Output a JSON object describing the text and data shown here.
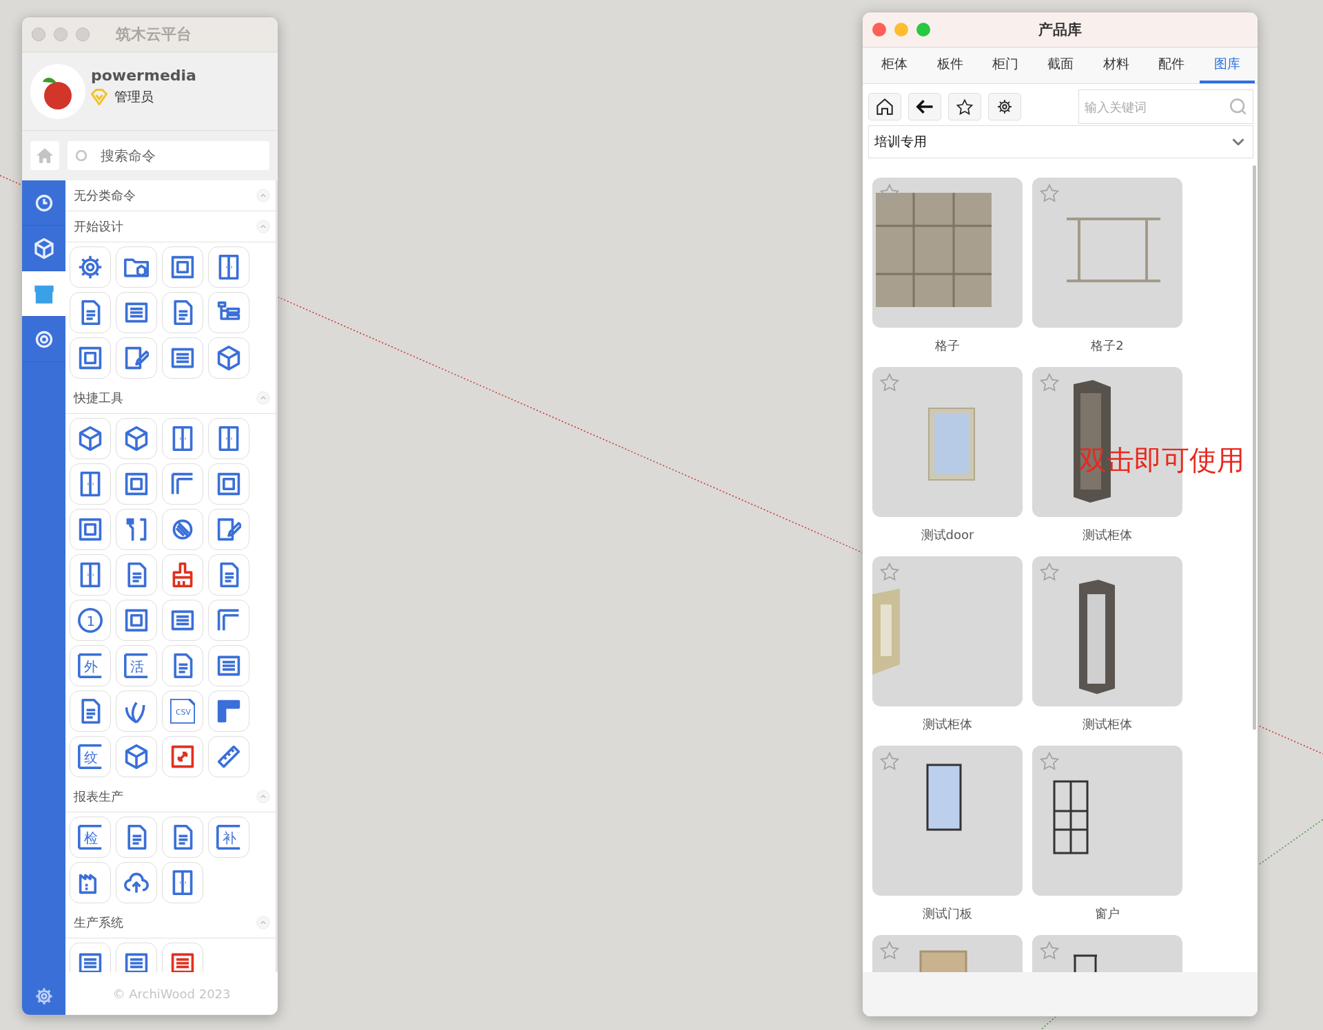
{
  "left_window": {
    "title": "筑木云平台",
    "user": {
      "name": "powermedia",
      "role": "管理员"
    },
    "search": {
      "placeholder": "搜索命令"
    },
    "nav": [
      {
        "selected": false
      },
      {
        "selected": false
      },
      {
        "selected": true
      },
      {
        "selected": false
      }
    ],
    "sections": [
      {
        "title": "无分类命令"
      },
      {
        "title": "开始设计",
        "tools": [
          {
            "kind": "gear",
            "color": "#3a6fd8"
          },
          {
            "kind": "folder",
            "color": "#3a6fd8"
          },
          {
            "kind": "frame",
            "color": "#3a6fd8"
          },
          {
            "kind": "door",
            "color": "#3a6fd8"
          },
          {
            "kind": "doc",
            "color": "#3a6fd8"
          },
          {
            "kind": "list",
            "color": "#3a6fd8"
          },
          {
            "kind": "doc",
            "color": "#3a6fd8"
          },
          {
            "kind": "tree",
            "color": "#3a6fd8"
          },
          {
            "kind": "frame",
            "color": "#3a6fd8"
          },
          {
            "kind": "pencil",
            "color": "#3a6fd8"
          },
          {
            "kind": "list",
            "color": "#3a6fd8"
          },
          {
            "kind": "cube",
            "color": "#3a6fd8"
          }
        ]
      },
      {
        "title": "快捷工具",
        "tools": [
          {
            "kind": "cube",
            "color": "#3a6fd8"
          },
          {
            "kind": "cube",
            "color": "#3a6fd8"
          },
          {
            "kind": "door",
            "color": "#3a6fd8"
          },
          {
            "kind": "door",
            "color": "#3a6fd8"
          },
          {
            "kind": "door",
            "color": "#3a6fd8"
          },
          {
            "kind": "frame",
            "color": "#3a6fd8"
          },
          {
            "kind": "corner-line",
            "color": "#3a6fd8"
          },
          {
            "kind": "frame",
            "color": "#3a6fd8"
          },
          {
            "kind": "frame",
            "color": "#3a6fd8"
          },
          {
            "kind": "wrench",
            "color": "#3a6fd8"
          },
          {
            "kind": "circle",
            "color": "#3a6fd8"
          },
          {
            "kind": "pencil",
            "color": "#3a6fd8"
          },
          {
            "kind": "door",
            "color": "#3a6fd8"
          },
          {
            "kind": "doc",
            "color": "#3a6fd8"
          },
          {
            "kind": "brush",
            "color": "#e0301e"
          },
          {
            "kind": "doc",
            "color": "#3a6fd8"
          },
          {
            "kind": "text-circle",
            "label": "1",
            "color": "#3a6fd8"
          },
          {
            "kind": "frame",
            "color": "#3a6fd8"
          },
          {
            "kind": "list",
            "color": "#3a6fd8"
          },
          {
            "kind": "corner-line",
            "color": "#3a6fd8"
          },
          {
            "kind": "text",
            "label": "外",
            "color": "#3a6fd8"
          },
          {
            "kind": "text",
            "label": "活",
            "color": "#3a6fd8"
          },
          {
            "kind": "doc",
            "color": "#3a6fd8"
          },
          {
            "kind": "list",
            "color": "#3a6fd8"
          },
          {
            "kind": "doc",
            "color": "#3a6fd8"
          },
          {
            "kind": "plant",
            "color": "#3a6fd8"
          },
          {
            "kind": "text-doc",
            "label": "CSV",
            "color": "#3a6fd8"
          },
          {
            "kind": "corner",
            "color": "#3a6fd8"
          },
          {
            "kind": "text",
            "label": "纹",
            "color": "#3a6fd8"
          },
          {
            "kind": "cube",
            "color": "#3a6fd8"
          },
          {
            "kind": "resize",
            "color": "#e0301e"
          },
          {
            "kind": "ruler",
            "color": "#3a6fd8"
          }
        ]
      },
      {
        "title": "报表生产",
        "tools": [
          {
            "kind": "text",
            "label": "检",
            "color": "#3a6fd8"
          },
          {
            "kind": "doc",
            "color": "#3a6fd8"
          },
          {
            "kind": "doc",
            "color": "#3a6fd8"
          },
          {
            "kind": "text",
            "label": "补",
            "color": "#3a6fd8"
          },
          {
            "kind": "factory",
            "color": "#3a6fd8"
          },
          {
            "kind": "cloud",
            "color": "#3a6fd8"
          },
          {
            "kind": "door",
            "color": "#3a6fd8"
          }
        ]
      },
      {
        "title": "生产系统",
        "tools": [
          {
            "kind": "list",
            "color": "#3a6fd8"
          },
          {
            "kind": "list",
            "color": "#3a6fd8"
          },
          {
            "kind": "list",
            "color": "#e0301e"
          }
        ]
      }
    ],
    "footer": "© ArchiWood 2023"
  },
  "right_window": {
    "title": "产品库",
    "tabs": [
      {
        "label": "柜体",
        "selected": false
      },
      {
        "label": "板件",
        "selected": false
      },
      {
        "label": "柜门",
        "selected": false
      },
      {
        "label": "截面",
        "selected": false
      },
      {
        "label": "材料",
        "selected": false
      },
      {
        "label": "配件",
        "selected": false
      },
      {
        "label": "图库",
        "selected": true
      }
    ],
    "search": {
      "placeholder": "输入关键词"
    },
    "category": "培训专用",
    "products": [
      {
        "name": "格子",
        "favorite": false
      },
      {
        "name": "格子2",
        "favorite": false
      },
      {
        "name": "测试door",
        "favorite": false
      },
      {
        "name": "测试柜体",
        "favorite": false
      },
      {
        "name": "测试柜体",
        "favorite": false
      },
      {
        "name": "测试柜体",
        "favorite": false
      },
      {
        "name": "测试门板",
        "favorite": false
      },
      {
        "name": "窗户",
        "favorite": false
      },
      {
        "favorite": false
      },
      {
        "favorite": false
      }
    ],
    "annotation": "双击即可使用"
  }
}
